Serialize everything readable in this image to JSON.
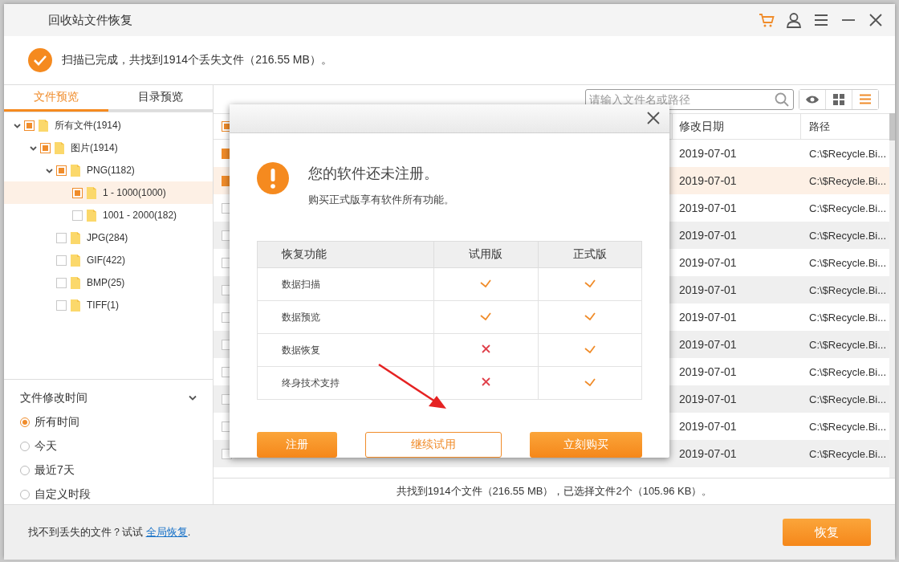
{
  "window": {
    "title": "回收站文件恢复"
  },
  "scan_status": "扫描已完成，共找到1914个丢失文件（216.55 MB）。",
  "view_tabs": [
    {
      "label": "文件预览",
      "selected": true
    },
    {
      "label": "目录预览",
      "selected": false
    }
  ],
  "tree": [
    {
      "label": "所有文件(1914)",
      "checked": true,
      "selected": false,
      "expanded": true,
      "children": [
        {
          "label": "图片(1914)",
          "checked": true,
          "selected": false,
          "expanded": true,
          "children": [
            {
              "label": "PNG(1182)",
              "checked": true,
              "selected": false,
              "expanded": true,
              "children": [
                {
                  "label": "1 - 1000(1000)",
                  "checked": true,
                  "selected": true
                },
                {
                  "label": "1001 - 2000(182)",
                  "checked": false,
                  "selected": false
                }
              ]
            },
            {
              "label": "JPG(284)",
              "checked": false,
              "selected": false
            },
            {
              "label": "GIF(422)",
              "checked": false,
              "selected": false
            },
            {
              "label": "BMP(25)",
              "checked": false,
              "selected": false
            },
            {
              "label": "TIFF(1)",
              "checked": false,
              "selected": false
            }
          ]
        }
      ]
    }
  ],
  "time_filter": {
    "title": "文件修改时间",
    "options": [
      {
        "label": "所有时间",
        "selected": true
      },
      {
        "label": "今天",
        "selected": false
      },
      {
        "label": "最近7天",
        "selected": false
      },
      {
        "label": "自定义时段",
        "selected": false
      }
    ]
  },
  "search": {
    "placeholder": "请输入文件名或路径"
  },
  "view_modes": [
    {
      "kind": "preview",
      "selected": false
    },
    {
      "kind": "grid",
      "selected": false
    },
    {
      "kind": "list",
      "selected": true
    }
  ],
  "file_table": {
    "header_checked": true,
    "columns": [
      "修改日期",
      "路径"
    ],
    "rows": [
      {
        "checked": true,
        "selected": false,
        "date": "2019-07-01",
        "path": "C:\\$Recycle.Bi..."
      },
      {
        "checked": true,
        "selected": true,
        "date": "2019-07-01",
        "path": "C:\\$Recycle.Bi..."
      },
      {
        "checked": false,
        "selected": false,
        "date": "2019-07-01",
        "path": "C:\\$Recycle.Bi..."
      },
      {
        "checked": false,
        "selected": false,
        "date": "2019-07-01",
        "path": "C:\\$Recycle.Bi..."
      },
      {
        "checked": false,
        "selected": false,
        "date": "2019-07-01",
        "path": "C:\\$Recycle.Bi..."
      },
      {
        "checked": false,
        "selected": false,
        "date": "2019-07-01",
        "path": "C:\\$Recycle.Bi..."
      },
      {
        "checked": false,
        "selected": false,
        "date": "2019-07-01",
        "path": "C:\\$Recycle.Bi..."
      },
      {
        "checked": false,
        "selected": false,
        "date": "2019-07-01",
        "path": "C:\\$Recycle.Bi..."
      },
      {
        "checked": false,
        "selected": false,
        "date": "2019-07-01",
        "path": "C:\\$Recycle.Bi..."
      },
      {
        "checked": false,
        "selected": false,
        "date": "2019-07-01",
        "path": "C:\\$Recycle.Bi..."
      },
      {
        "checked": false,
        "selected": false,
        "date": "2019-07-01",
        "path": "C:\\$Recycle.Bi..."
      },
      {
        "checked": false,
        "selected": false,
        "date": "2019-07-01",
        "path": "C:\\$Recycle.Bi..."
      }
    ]
  },
  "summary": "共找到1914个文件（216.55 MB），已选择文件2个（105.96 KB）。",
  "footer": {
    "prompt": "找不到丢失的文件？试试 ",
    "link": "全局恢复",
    "end": ".",
    "recover_button": "恢复"
  },
  "dialog": {
    "title": "您的软件还未注册。",
    "subtitle": "购买正式版享有软件所有功能。",
    "columns": [
      "恢复功能",
      "试用版",
      "正式版"
    ],
    "rows": [
      {
        "feature": "数据扫描",
        "trial": true,
        "full": true
      },
      {
        "feature": "数据预览",
        "trial": true,
        "full": true
      },
      {
        "feature": "数据恢复",
        "trial": false,
        "full": true
      },
      {
        "feature": "终身技术支持",
        "trial": false,
        "full": true
      }
    ],
    "buttons": [
      {
        "label": "注册",
        "kind": "primary"
      },
      {
        "label": "继续试用",
        "kind": "outline"
      },
      {
        "label": "立刻购买",
        "kind": "primary"
      }
    ]
  }
}
